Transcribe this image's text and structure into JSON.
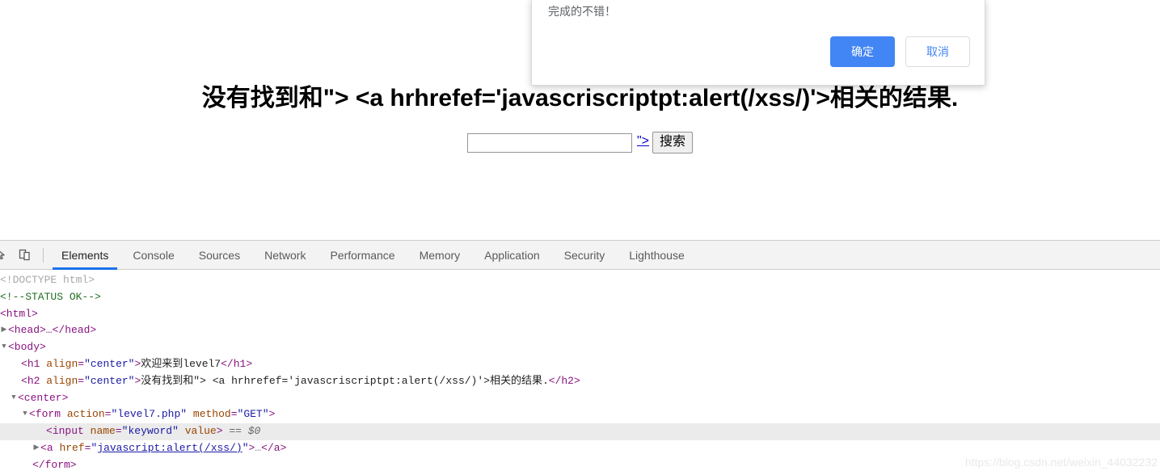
{
  "page": {
    "heading": "没有找到和\"> <a hrhrefef='javascriscriptpt:alert(/xss/)'>相关的结果.",
    "search": {
      "input_value": "",
      "input_placeholder": "",
      "link_text": "\">",
      "button_label": "搜索"
    }
  },
  "dialog": {
    "message": "完成的不错！",
    "ok_label": "确定",
    "cancel_label": "取消",
    "ok_color": "#4285f4",
    "cancel_text_color": "#4285f4"
  },
  "devtools": {
    "toolbar": {
      "inspect_icon": "inspect-element-icon",
      "device_icon": "device-toolbar-icon"
    },
    "tabs": [
      {
        "label": "Elements",
        "active": true
      },
      {
        "label": "Console",
        "active": false
      },
      {
        "label": "Sources",
        "active": false
      },
      {
        "label": "Network",
        "active": false
      },
      {
        "label": "Performance",
        "active": false
      },
      {
        "label": "Memory",
        "active": false
      },
      {
        "label": "Application",
        "active": false
      },
      {
        "label": "Security",
        "active": false
      },
      {
        "label": "Lighthouse",
        "active": false
      }
    ],
    "active_tab": "Elements",
    "dom": {
      "l1_doctype": "<!DOCTYPE html>",
      "l2_comment": "<!--STATUS OK-->",
      "l3_html": "<html>",
      "l4_head": "<head>…</head>",
      "l5_body": "<body>",
      "l6_h1": "<h1 align=\"center\">欢迎来到level7</h1>",
      "l6_h1_tag": "h1",
      "l6_h1_attr": "align",
      "l6_h1_val": "\"center\"",
      "l6_h1_text": "欢迎来到level7",
      "l7_h2_tag": "h2",
      "l7_h2_attr": "align",
      "l7_h2_val": "\"center\"",
      "l7_h2_text": "没有找到和\"> <a hrhrefef='javascriscriptpt:alert(/xss/)'>相关的结果.",
      "l8_center": "<center>",
      "l9_form_tag": "form",
      "l9_form_attr1": "action",
      "l9_form_val1": "\"level7.php\"",
      "l9_form_attr2": "method",
      "l9_form_val2": "\"GET\"",
      "l10_input_tag": "input",
      "l10_input_attr1": "name",
      "l10_input_val1": "\"keyword\"",
      "l10_input_attr2": "value",
      "l10_selected_marker": "== $0",
      "l11_a_tag": "a",
      "l11_a_attr": "href",
      "l11_a_val_quote_open": "\"",
      "l11_a_val_link": "javascript:alert(/xss/)",
      "l11_a_val_quote_close": "\"",
      "l11_a_ellipsis": "…",
      "l11_a_close": "</a>",
      "l12_form_close": "</form>"
    }
  },
  "watermark": "https://blog.csdn.net/weixin_44032232"
}
